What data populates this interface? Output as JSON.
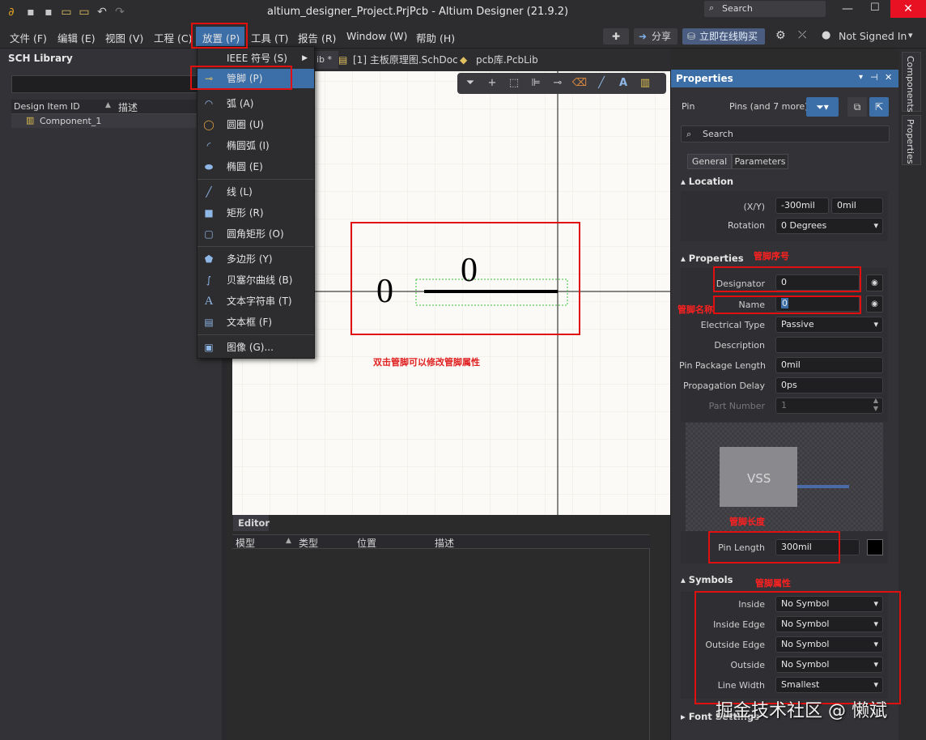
{
  "window": {
    "title": "altium_designer_Project.PrjPcb - Altium Designer (21.9.2)",
    "search_placeholder": "Search"
  },
  "menubar": {
    "items": [
      "文件 (F)",
      "编辑 (E)",
      "视图 (V)",
      "工程 (C)",
      "放置 (P)",
      "工具 (T)",
      "报告 (R)",
      "Window (W)",
      "帮助 (H)"
    ],
    "share": "分享",
    "buy": "立即在线购买",
    "user": "Not Signed In"
  },
  "left_panel": {
    "title": "SCH Library",
    "columns": [
      "Design Item ID",
      "描述"
    ],
    "items": [
      "Component_1"
    ]
  },
  "tabs": [
    "ib *",
    "[1] 主板原理图.SchDoc",
    "pcb库.PcbLib"
  ],
  "place_menu": {
    "items": [
      {
        "icon": "ieee-icon",
        "label": "IEEE 符号 (S)",
        "submenu": true
      },
      {
        "icon": "pin-icon",
        "label": "管脚 (P)"
      },
      {
        "icon": "arc-icon",
        "label": "弧 (A)"
      },
      {
        "icon": "full-circle-icon",
        "label": "圆圈 (U)"
      },
      {
        "icon": "elliptical-arc-icon",
        "label": "椭圆弧 (I)"
      },
      {
        "icon": "ellipse-icon",
        "label": "椭圆 (E)"
      },
      {
        "icon": "line-icon",
        "label": "线 (L)"
      },
      {
        "icon": "rectangle-icon",
        "label": "矩形 (R)"
      },
      {
        "icon": "round-rectangle-icon",
        "label": "圆角矩形 (O)"
      },
      {
        "icon": "polygon-icon",
        "label": "多边形 (Y)"
      },
      {
        "icon": "bezier-icon",
        "label": "贝塞尔曲线 (B)"
      },
      {
        "icon": "text-string-icon",
        "label": "文本字符串 (T)"
      },
      {
        "icon": "text-frame-icon",
        "label": "文本框 (F)"
      },
      {
        "icon": "image-icon",
        "label": "图像 (G)..."
      }
    ]
  },
  "canvas": {
    "pin_designator": "0",
    "pin_name": "0",
    "annotation": "双击管脚可以修改管脚属性"
  },
  "editor": {
    "title": "Editor",
    "columns": [
      "模型",
      "类型",
      "位置",
      "描述"
    ]
  },
  "properties": {
    "title": "Properties",
    "object": "Pin",
    "filter": "Pins (and 7 more)",
    "search_placeholder": "Search",
    "tabs": [
      "General",
      "Parameters"
    ],
    "location_title": "Location",
    "xy_label": "(X/Y)",
    "x": "-300mil",
    "y": "0mil",
    "rotation_label": "Rotation",
    "rotation": "0 Degrees",
    "props_title": "Properties",
    "designator_label": "Designator",
    "designator": "0",
    "name_label": "Name",
    "name": "0",
    "electrical_type_label": "Electrical Type",
    "electrical_type": "Passive",
    "description_label": "Description",
    "description": "",
    "pin_package_length_label": "Pin Package Length",
    "pin_package_length": "0mil",
    "propagation_delay_label": "Propagation Delay",
    "propagation_delay": "0ps",
    "part_number_label": "Part Number",
    "part_number": "1",
    "preview_text": "VSS",
    "pin_length_label": "Pin Length",
    "pin_length": "300mil",
    "symbols_title": "Symbols",
    "inside_label": "Inside",
    "inside": "No Symbol",
    "inside_edge_label": "Inside Edge",
    "inside_edge": "No Symbol",
    "outside_edge_label": "Outside Edge",
    "outside_edge": "No Symbol",
    "outside_label": "Outside",
    "outside": "No Symbol",
    "line_width_label": "Line Width",
    "line_width": "Smallest",
    "font_settings_title": "Font Settings"
  },
  "annotations": {
    "designator_note": "管脚序号",
    "name_note": "管脚名称",
    "pin_length_note": "管脚长度",
    "symbols_note": "管脚属性"
  },
  "side_strip": [
    "Components",
    "Properties"
  ],
  "watermark": "掘金技术社区 @ 懒斌"
}
